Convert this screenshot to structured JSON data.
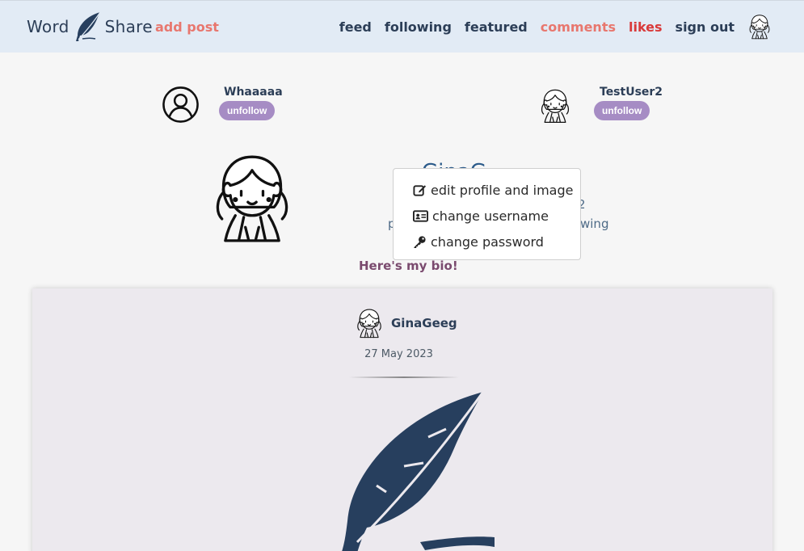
{
  "brand": {
    "word1": "Word",
    "word2": "Share"
  },
  "nav": {
    "add_post": "add post",
    "links": [
      {
        "label": "feed",
        "color": "#2c3e57"
      },
      {
        "label": "following",
        "color": "#2c3e57"
      },
      {
        "label": "featured",
        "color": "#2c3e57"
      },
      {
        "label": "comments",
        "color": "#e8776e"
      },
      {
        "label": "likes",
        "color": "#d93a3a"
      },
      {
        "label": "sign out",
        "color": "#2c3e57"
      }
    ]
  },
  "following": [
    {
      "name": "Whaaaaa",
      "button": "unfollow",
      "avatar": "user-circle-icon"
    },
    {
      "name": "TestUser2",
      "button": "unfollow",
      "avatar": "cartoon-avatar"
    }
  ],
  "profile": {
    "name": "GinaG",
    "stat_a": "2",
    "stat_b_prefix": "p",
    "stat_b_suffix": "wing",
    "bio": "Here's my bio!"
  },
  "dropdown": {
    "items": [
      {
        "label": "edit profile and image",
        "icon": "edit-icon"
      },
      {
        "label": "change username",
        "icon": "id-card-icon"
      },
      {
        "label": "change password",
        "icon": "key-icon"
      }
    ]
  },
  "post": {
    "author": "GinaGeeg",
    "date": "27 May 2023",
    "image": "feather-image"
  },
  "colors": {
    "navbar_bg": "#e2ebf5",
    "accent": "#e8776e",
    "likes": "#d93a3a",
    "button": "#a68cc4",
    "navy": "#2c3e57"
  }
}
